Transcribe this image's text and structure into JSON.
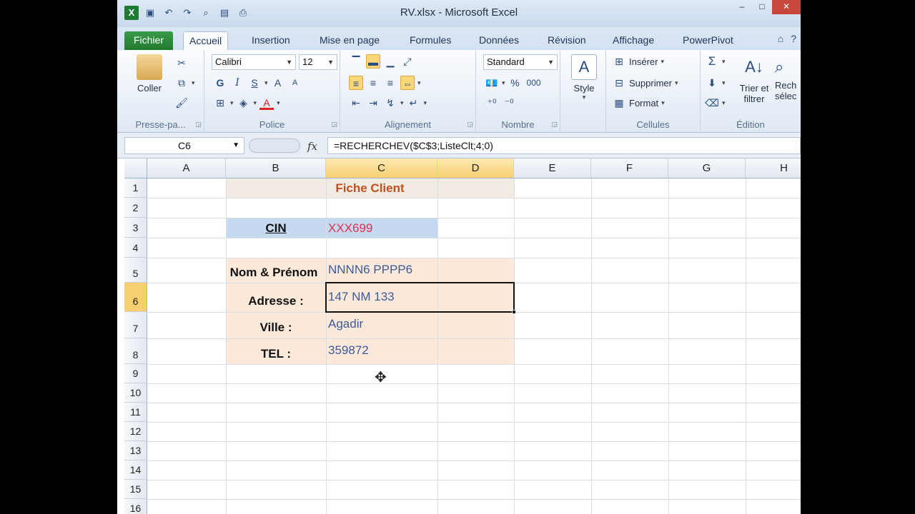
{
  "window": {
    "title": "RV.xlsx - Microsoft Excel",
    "qat_icons": [
      "excel-icon",
      "save-icon",
      "undo-icon",
      "redo-icon",
      "print-preview-icon",
      "new-icon",
      "quick-print-icon"
    ],
    "controls": {
      "minimize": "–",
      "maximize": "□",
      "close": "✕"
    }
  },
  "tabs": [
    {
      "label": "Fichier"
    },
    {
      "label": "Accueil"
    },
    {
      "label": "Insertion"
    },
    {
      "label": "Mise en page"
    },
    {
      "label": "Formules"
    },
    {
      "label": "Données"
    },
    {
      "label": "Révision"
    },
    {
      "label": "Affichage"
    },
    {
      "label": "PowerPivot"
    }
  ],
  "ribbon": {
    "clipboard": {
      "paste_label": "Coller",
      "group_label": "Presse-pa..."
    },
    "font": {
      "name": "Calibri",
      "size": "12",
      "bold": "G",
      "italic": "I",
      "underline": "S",
      "grow": "A",
      "shrink": "A",
      "font_color_letter": "A",
      "group_label": "Police"
    },
    "alignment": {
      "group_label": "Alignement"
    },
    "number": {
      "format": "Standard",
      "percent": "%",
      "thousands": "000",
      "group_label": "Nombre"
    },
    "styles": {
      "style_label": "Style"
    },
    "cells": {
      "insert": "Insérer",
      "delete": "Supprimer",
      "format": "Format",
      "group_label": "Cellules"
    },
    "editing": {
      "sort_filter_1": "Trier et",
      "sort_filter_2": "filtrer",
      "find_1": "Rech",
      "find_2": "sélec",
      "sigma": "Σ",
      "group_label": "Édition"
    }
  },
  "formula_bar": {
    "name_box": "C6",
    "fx": "fx",
    "formula": "=RECHERCHEV($C$3;ListeClt;4;0)"
  },
  "sheet": {
    "columns": [
      "A",
      "B",
      "C",
      "D",
      "E",
      "F",
      "G",
      "H"
    ],
    "rows": [
      "1",
      "2",
      "3",
      "4",
      "5",
      "6",
      "7",
      "8",
      "9",
      "10",
      "11",
      "12",
      "13",
      "14",
      "15",
      "16"
    ],
    "title": "Fiche Client",
    "cin_label": "CIN",
    "cin_value": "XXX699",
    "labels": {
      "nom": "Nom & Prénom",
      "adresse": "Adresse :",
      "ville": "Ville :",
      "tel": "TEL :"
    },
    "values": {
      "nom": "NNNN6 PPPP6",
      "adresse": "147 NM 133",
      "ville": "Agadir",
      "tel": "359872"
    },
    "selected_cell": "C6"
  },
  "colors": {
    "title_fill": "#f1ebe4",
    "cin_fill": "#c5d9f1",
    "form_fill": "#fde9d9",
    "title_text": "#c0501d",
    "cin_value_text": "#e03050",
    "value_text": "#3c5a9a"
  }
}
